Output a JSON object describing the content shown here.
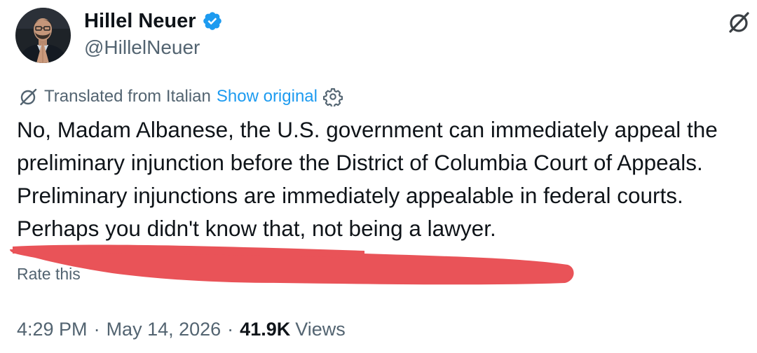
{
  "author": {
    "display_name": "Hillel Neuer",
    "handle": "@HillelNeuer",
    "verified": true,
    "verified_color": "#1d9bf0"
  },
  "translation": {
    "label": "Translated from Italian",
    "show_original_label": "Show original",
    "icon": "translate-icon",
    "settings_icon": "gear-icon"
  },
  "tweet": {
    "lines": [
      "No, Madam Albanese, the U.S. government can immediately appeal the",
      "preliminary injunction before the District of Columbia Court of Appeals.",
      "Preliminary injunctions are immediately appealable in federal courts.",
      "Perhaps you didn't know that, not being a lawyer."
    ]
  },
  "rate": {
    "visible_text": "Rate this"
  },
  "meta": {
    "time": "4:29 PM",
    "date": "May 14, 2026",
    "separator": "·",
    "views_count": "41.9K",
    "views_label": "Views"
  },
  "colors": {
    "link": "#1d9bf0",
    "secondary_text": "#536471",
    "primary_text": "#0f1419",
    "redaction_marker": "#e95358"
  }
}
